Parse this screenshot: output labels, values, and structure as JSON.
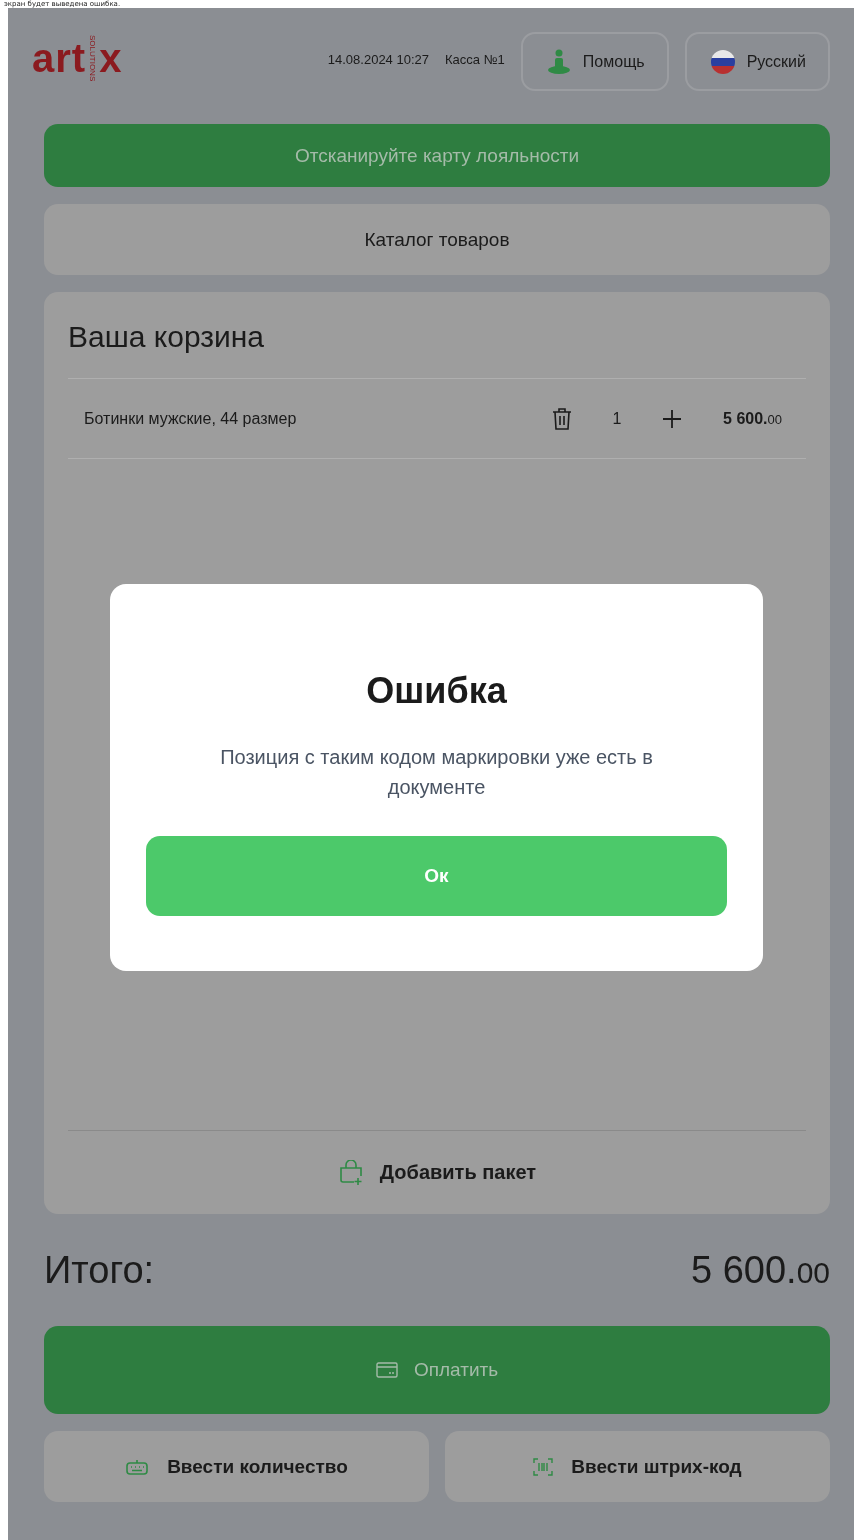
{
  "caption": "экран будет выведена ошибка.",
  "header": {
    "logo": {
      "left": "art",
      "right": "x",
      "tagline": "SOLUTIONS"
    },
    "datetime": "14.08.2024 10:27",
    "register": "Касса №1",
    "help_button": "Помощь",
    "language_button": "Русский"
  },
  "loyalty_button": "Отсканируйте карту лояльности",
  "catalog_button": "Каталог товаров",
  "cart": {
    "title": "Ваша корзина",
    "items": [
      {
        "name": "Ботинки мужские, 44 размер",
        "quantity": "1",
        "price": "5 600.",
        "price_fraction": "00"
      }
    ],
    "add_bag_button": "Добавить пакет"
  },
  "total": {
    "label": "Итого:",
    "amount": "5 600.",
    "amount_fraction": "00"
  },
  "pay_button": "Оплатить",
  "bottom_buttons": [
    {
      "kind": "quantity",
      "label": "Ввести количество"
    },
    {
      "kind": "barcode",
      "label": "Ввести штрих-код"
    }
  ],
  "dialog": {
    "title": "Ошибка",
    "message": "Позиция с таким кодом маркировки уже есть в документе",
    "button": "Ок"
  }
}
